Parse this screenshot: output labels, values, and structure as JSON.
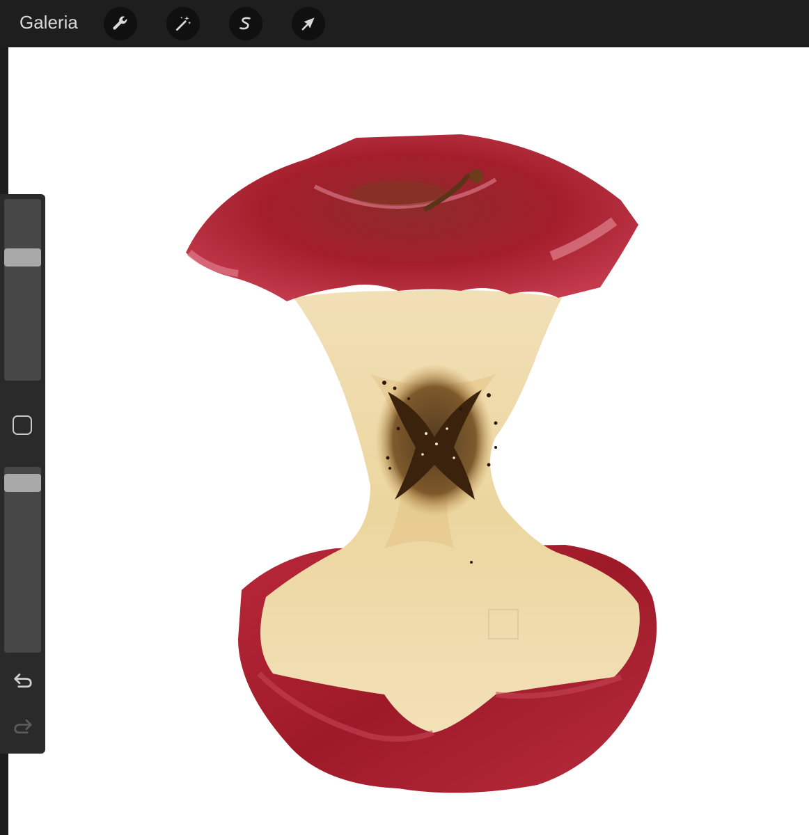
{
  "topbar": {
    "gallery_label": "Galeria",
    "tools": [
      {
        "name": "actions",
        "icon": "wrench-icon"
      },
      {
        "name": "adjustments",
        "icon": "magic-wand-icon"
      },
      {
        "name": "selection",
        "icon": "selection-s-icon"
      },
      {
        "name": "transform",
        "icon": "arrow-cursor-icon"
      }
    ]
  },
  "sidebar": {
    "brush_size_value": 0.7,
    "opacity_value": 0.96,
    "modifier_icon": "square-modifier-icon",
    "undo_icon": "undo-icon",
    "redo_icon": "redo-icon",
    "redo_enabled": false
  },
  "canvas": {
    "background": "#ffffff",
    "artwork": "apple-core-painting"
  },
  "colors": {
    "toolbar_bg": "#1e1e1e",
    "sidebar_bg": "#2a2a2a",
    "thumb": "#a9a9a9",
    "apple_red": "#a01f2c",
    "flesh": "#efdcb0",
    "seed_core": "#4a2e12"
  }
}
